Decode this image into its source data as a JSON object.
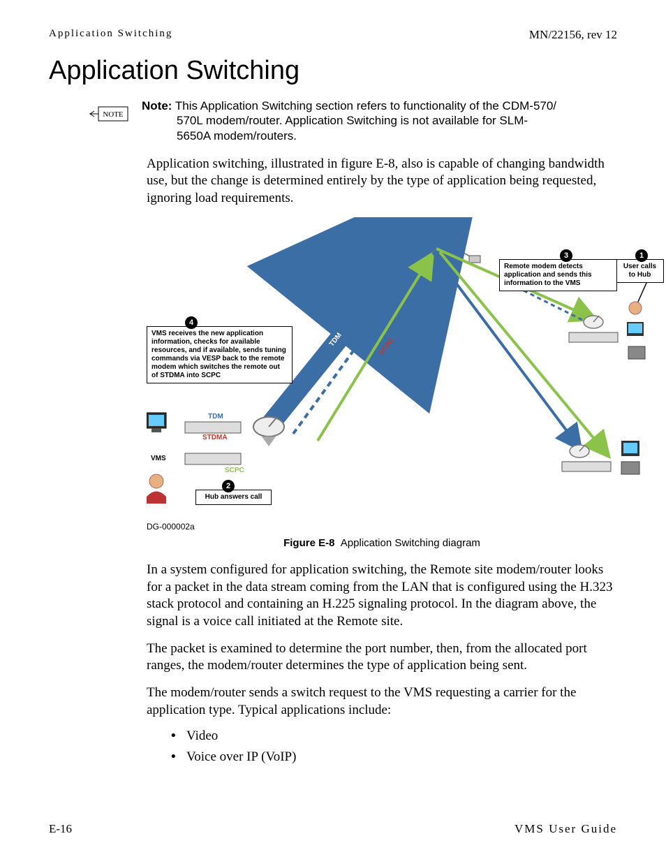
{
  "header": {
    "left": "Application Switching",
    "right": "MN/22156, rev 12"
  },
  "title": "Application Switching",
  "note": {
    "label": "Note:",
    "icon_text": "NOTE",
    "line1": "This Application Switching section refers to functionality of the CDM-570/",
    "line2": "570L modem/router. Application Switching is not available for SLM-",
    "line3": "5650A modem/routers."
  },
  "para1": "Application switching, illustrated in figure E-8, also is capable of changing bandwidth use, but the change is determined entirely by the type of application being requested, ignoring load requirements.",
  "diagram": {
    "badge1": "1",
    "badge2": "2",
    "badge3": "3",
    "badge4": "4",
    "box1": "User calls to Hub",
    "box2": "Hub answers call",
    "box3": "Remote modem detects application and sends this information to the VMS",
    "box4": "VMS receives the new application information, checks for available resources, and if available, sends tuning commands via VESP back to the remote modem which switches the remote out of STDMA into SCPC",
    "link_tdm": "TDM",
    "link_stdma": "STDMA",
    "link_scpc": "SCPC",
    "lbl_tdm": "TDM",
    "lbl_stdma": "STDMA",
    "lbl_scpc": "SCPC",
    "lbl_vms": "VMS",
    "dg": "DG-000002a"
  },
  "figure": {
    "num": "Figure E-8",
    "caption": "Application Switching diagram"
  },
  "para2": "In a system configured for application switching, the Remote site modem/router looks for a packet in the data stream coming from the LAN that is configured using the H.323 stack protocol and containing an H.225 signaling protocol. In the diagram above, the signal is a voice call initiated at the Remote site.",
  "para3": "The packet is examined to determine the port number, then, from the allocated port ranges, the modem/router determines the type of application being sent.",
  "para4": "The modem/router sends a switch request to the VMS requesting a carrier for the application type. Typical applications include:",
  "bullets": {
    "b1": "Video",
    "b2": "Voice over IP (VoIP)"
  },
  "footer": {
    "left": "E-16",
    "right": "VMS User Guide"
  }
}
